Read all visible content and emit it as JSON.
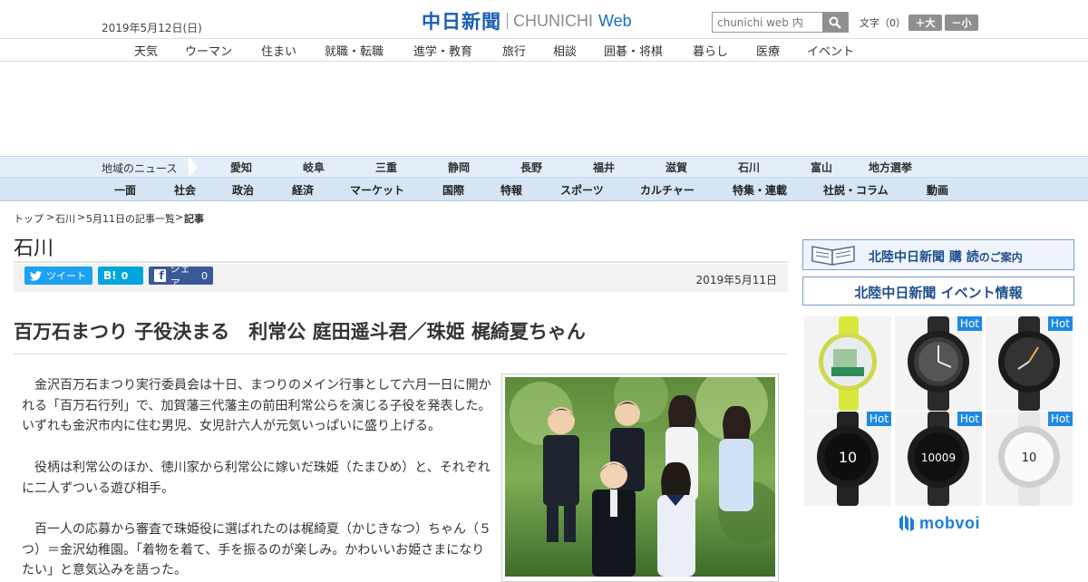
{
  "header": {
    "date": "2019年5月12日(日)",
    "logo_jp": "中日新聞",
    "logo_en": "CHUNICHI",
    "logo_web": "Web",
    "search_placeholder": "chunichi web 内",
    "font_label": "文字（0）",
    "font_plus": "＋大",
    "font_minus": "－小"
  },
  "category_nav": [
    "天気",
    "ウーマン",
    "住まい",
    "就職・転職",
    "進学・教育",
    "旅行",
    "相談",
    "囲碁・将棋",
    "暮らし",
    "医療",
    "イベント"
  ],
  "region_nav": {
    "label": "地域のニュース",
    "items": [
      "愛知",
      "岐阜",
      "三重",
      "静岡",
      "長野",
      "福井",
      "滋賀",
      "石川",
      "富山",
      "地方選挙"
    ]
  },
  "section_nav": [
    "一面",
    "社会",
    "政治",
    "経済",
    "マーケット",
    "国際",
    "特報",
    "スポーツ",
    "カルチャー",
    "特集・連載",
    "社説・コラム",
    "動画"
  ],
  "breadcrumb": {
    "items": [
      "トップ",
      "石川",
      "5月11日の記事一覧",
      "記事"
    ],
    "separator": ">"
  },
  "section_title": "石川",
  "share": {
    "tweet": "ツイート",
    "hatena_count": "0",
    "fb_label": "シェア",
    "fb_count": "0"
  },
  "article": {
    "date": "2019年5月11日",
    "headline": "百万石まつり 子役決まる　利常公 庭田遥斗君／珠姫 梶綺夏ちゃん",
    "paragraphs": [
      "金沢百万石まつり実行委員会は十日、まつりのメイン行事として六月一日に開かれる「百万石行列」で、加賀藩三代藩主の前田利常公らを演じる子役を発表した。いずれも金沢市内に住む男児、女児計六人が元気いっぱいに盛り上げる。",
      "役柄は利常公のほか、徳川家から利常公に嫁いだ珠姫（たまひめ）と、それぞれに二人ずついる遊び相手。",
      "百一人の応募から審査で珠姫役に選ばれたのは梶綺夏（かじきなつ）ちゃん（５つ）＝金沢幼稚園。「着物を着て、手を振るのが楽しみ。かわいいお姫さまになりたい」と意気込みを語った。"
    ]
  },
  "sidebar": {
    "banner1_main": "北陸中日新聞 購 読",
    "banner1_sub": "のご案内",
    "banner2": "北陸中日新聞 イベント情報",
    "hot_label": "Hot",
    "ad_brand": "mobvoi"
  },
  "colors": {
    "brand_blue": "#1a5fb4",
    "region_bg": "#e3eef8",
    "section_bg": "#d5e5f3",
    "twitter": "#1da1f2",
    "hatena": "#00a4de",
    "facebook": "#3b5998"
  }
}
